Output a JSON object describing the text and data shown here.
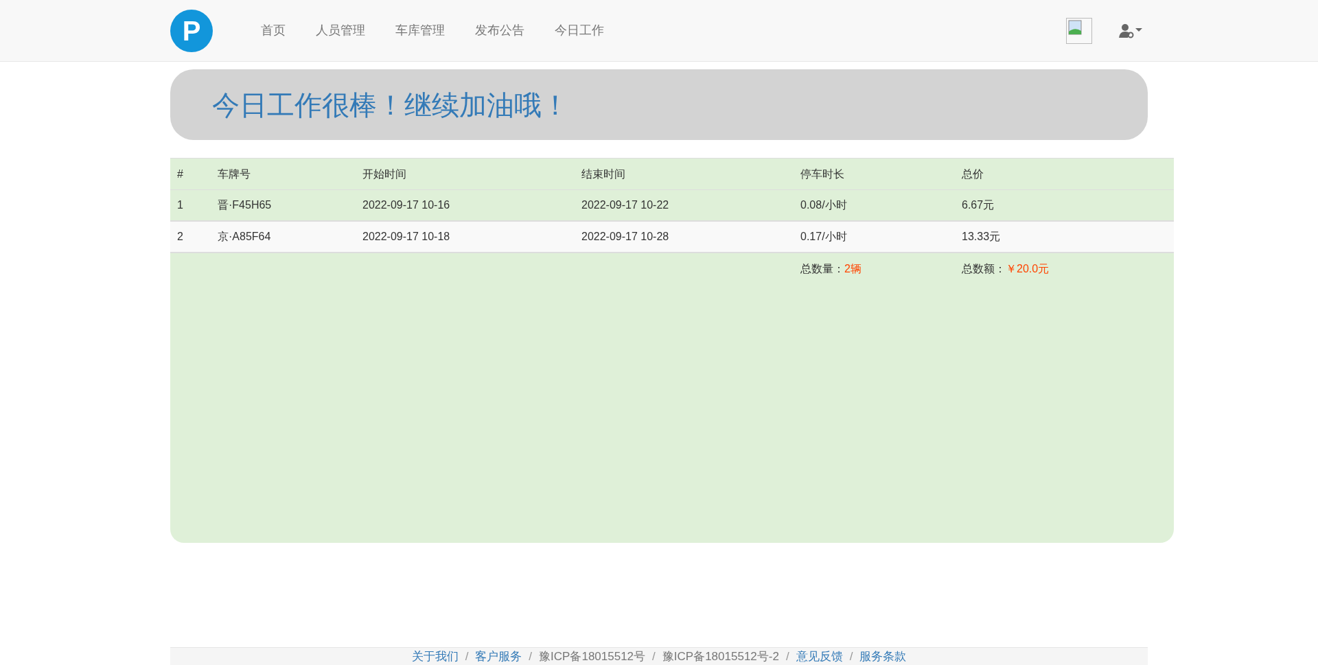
{
  "navbar": {
    "logo": "P",
    "items": [
      "首页",
      "人员管理",
      "车库管理",
      "发布公告",
      "今日工作"
    ]
  },
  "banner": {
    "title": "今日工作很棒！继续加油哦！"
  },
  "table": {
    "columns": [
      "#",
      "车牌号",
      "开始时间",
      "结束时间",
      "停车时长",
      "总价"
    ],
    "rows": [
      {
        "kind": "success",
        "cells": [
          "1",
          "晋·F45H65",
          "2022-09-17 10-16",
          "2022-09-17 10-22",
          "0.08/小时",
          "6.67元"
        ]
      },
      {
        "kind": "striped",
        "cells": [
          "2",
          "京·A85F64",
          "2022-09-17 10-18",
          "2022-09-17 10-28",
          "0.17/小时",
          "13.33元"
        ]
      }
    ],
    "summary": {
      "count_label": "总数量：",
      "count_value": "2辆",
      "amount_label": "总数额：",
      "amount_value": "￥20.0元"
    }
  },
  "footer": {
    "separator": "/",
    "items": [
      {
        "kind": "link",
        "text": "关于我们"
      },
      {
        "kind": "link",
        "text": "客户服务"
      },
      {
        "kind": "text",
        "text": "豫ICP备18015512号"
      },
      {
        "kind": "text",
        "text": "豫ICP备18015512号-2"
      },
      {
        "kind": "link",
        "text": "意见反馈"
      },
      {
        "kind": "link",
        "text": "服务条款"
      }
    ]
  }
}
